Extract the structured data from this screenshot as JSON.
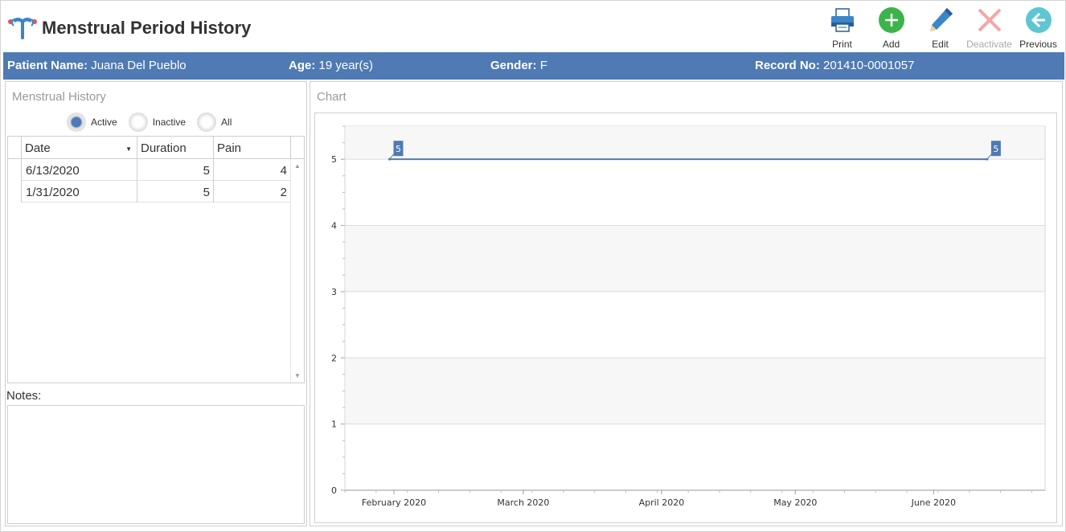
{
  "window": {
    "title": "Menstrual Period History"
  },
  "toolbar": {
    "print": "Print",
    "add": "Add",
    "edit": "Edit",
    "deactivate": "Deactivate",
    "previous": "Previous"
  },
  "patient": {
    "name_label": "Patient Name:",
    "name": "Juana Del Pueblo",
    "age_label": "Age:",
    "age": "19 year(s)",
    "gender_label": "Gender:",
    "gender": "F",
    "record_label": "Record No:",
    "record": "201410-0001057"
  },
  "history": {
    "title": "Menstrual History",
    "filters": [
      "Active",
      "Inactive",
      "All"
    ],
    "selected_filter": "Active",
    "columns": [
      "Date",
      "Duration",
      "Pain"
    ],
    "rows": [
      {
        "date": "6/13/2020",
        "duration": "5",
        "pain": "4"
      },
      {
        "date": "1/31/2020",
        "duration": "5",
        "pain": "2"
      }
    ],
    "notes_label": "Notes:"
  },
  "chart_panel": {
    "title": "Chart"
  },
  "colors": {
    "accent": "#4f7ab4",
    "add_green": "#3cb44a",
    "edit_blue": "#3a86c8",
    "deactivate_red": "#f4a6a6",
    "previous_teal": "#5ec6d0"
  },
  "chart_data": {
    "type": "line",
    "x": [
      "2020-01-31",
      "2020-06-13"
    ],
    "series": [
      {
        "values": [
          5,
          5
        ]
      }
    ],
    "data_labels": [
      "5",
      "5"
    ],
    "ylim": [
      0,
      5.5
    ],
    "yticks": [
      "0",
      "1",
      "2",
      "3",
      "4",
      "5"
    ],
    "xticks": [
      "February 2020",
      "March 2020",
      "April 2020",
      "May 2020",
      "June 2020"
    ],
    "xtick_dates": [
      "2020-02-01",
      "2020-03-01",
      "2020-04-01",
      "2020-05-01",
      "2020-06-01"
    ],
    "xlim": [
      "2020-01-21",
      "2020-06-26"
    ],
    "grid": true,
    "xlabel": "",
    "ylabel": ""
  }
}
